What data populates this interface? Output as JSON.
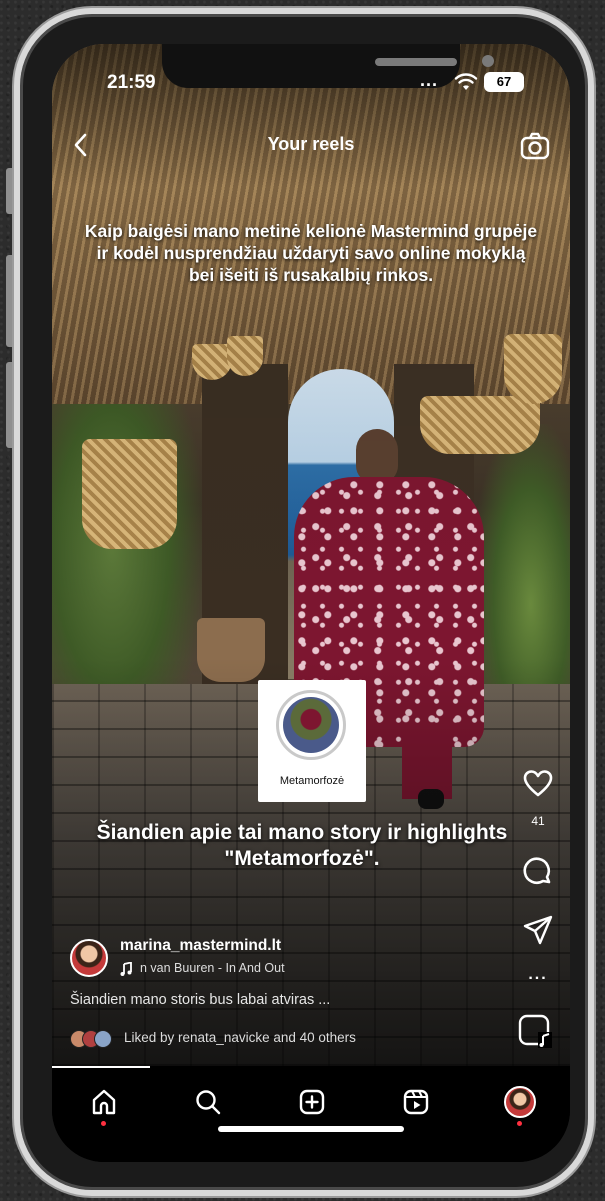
{
  "status_bar": {
    "time": "21:59",
    "battery": "67",
    "signal_dots": "..."
  },
  "header": {
    "title": "Your reels",
    "back_icon": "back-chevron-icon",
    "camera_icon": "camera-icon"
  },
  "reel": {
    "caption_top": "Kaip baigėsi mano metinė kelionė Mastermind grupėje ir kodėl nusprendžiau uždaryti savo online mokyklą bei išeiti iš rusakalbių rinkos.",
    "highlight_label": "Metamorfozė",
    "caption_mid": "Šiandien apie tai mano story ir highlights \"Metamorfozė\".",
    "username": "marina_mastermind.lt",
    "music": "n van Buuren - In And Out",
    "description": "Šiandien mano storis bus labai atviras ...",
    "liked_by": "Liked by renata_navicke and 40 others"
  },
  "actions": {
    "like_count": "41",
    "more": "..."
  },
  "tabbar": {
    "items": [
      "home",
      "search",
      "create",
      "reels",
      "profile"
    ],
    "active": "home"
  },
  "colors": {
    "notification_dot": "#ff3040",
    "background": "#000000",
    "text": "#ffffff"
  }
}
